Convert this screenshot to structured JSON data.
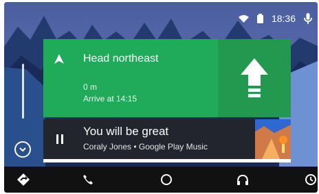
{
  "status_bar": {
    "time": "18:36"
  },
  "navigation": {
    "instruction": "Head northeast",
    "distance": "0 m",
    "arrival": "Arrive at 14:15"
  },
  "media": {
    "title": "You will be great",
    "subtitle": "Coraly Jones • Google Play Music",
    "progress": 1
  },
  "icons": {
    "wifi": "wifi-icon",
    "battery": "battery-icon",
    "mic": "mic-icon",
    "nav_arrow": "navigation-arrow-icon",
    "turn_arrow": "straight-arrow-icon",
    "pause": "pause-icon",
    "expand": "chevron-down-icon",
    "maps": "maps-icon",
    "phone": "phone-icon",
    "home": "home-icon",
    "headphones": "headphones-icon",
    "recent": "recent-icon"
  },
  "colors": {
    "nav_green": "#1fab59",
    "nav_dark_green": "#22994f",
    "media_bg": "#22252d",
    "bottom_bar": "#111111"
  }
}
